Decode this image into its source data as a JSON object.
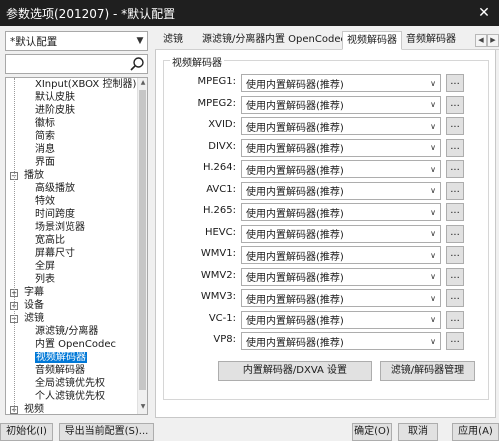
{
  "window": {
    "title": "参数选项(201207) - *默认配置",
    "close_label": "✕"
  },
  "profile_combo": {
    "value": "*默认配置"
  },
  "search": {
    "placeholder": ""
  },
  "tree": [
    {
      "label": "XInput(XBOX 控制器)",
      "level": 2
    },
    {
      "label": "默认皮肤",
      "level": 2
    },
    {
      "label": "进阶皮肤",
      "level": 2
    },
    {
      "label": "徽标",
      "level": 2
    },
    {
      "label": "简索",
      "level": 2
    },
    {
      "label": "消息",
      "level": 2
    },
    {
      "label": "界面",
      "level": 2
    },
    {
      "label": "播放",
      "level": 1,
      "expander": "−"
    },
    {
      "label": "高级播放",
      "level": 2
    },
    {
      "label": "特效",
      "level": 2
    },
    {
      "label": "时间跨度",
      "level": 2
    },
    {
      "label": "场景浏览器",
      "level": 2
    },
    {
      "label": "宽高比",
      "level": 2
    },
    {
      "label": "屏幕尺寸",
      "level": 2
    },
    {
      "label": "全屏",
      "level": 2
    },
    {
      "label": "列表",
      "level": 2
    },
    {
      "label": "字幕",
      "level": 1,
      "expander": "+"
    },
    {
      "label": "设备",
      "level": 1,
      "expander": "+"
    },
    {
      "label": "滤镜",
      "level": 1,
      "expander": "−"
    },
    {
      "label": "源滤镜/分离器",
      "level": 2
    },
    {
      "label": "内置 OpenCodec",
      "level": 2
    },
    {
      "label": "视频解码器",
      "level": 2,
      "selected": true
    },
    {
      "label": "音频解码器",
      "level": 2
    },
    {
      "label": "全局滤镜优先权",
      "level": 2
    },
    {
      "label": "个人滤镜优先权",
      "level": 2
    },
    {
      "label": "视频",
      "level": 1,
      "expander": "+"
    }
  ],
  "tabs": [
    {
      "label": "滤镜",
      "active": false
    },
    {
      "label": "源滤镜/分离器",
      "active": false
    },
    {
      "label": "内置 OpenCodec",
      "active": false
    },
    {
      "label": "视频解码器",
      "active": true
    },
    {
      "label": "音频解码器",
      "active": false
    }
  ],
  "tab_nav": {
    "prev": "◀",
    "next": "▶"
  },
  "group_title": "视频解码器",
  "decoders": [
    {
      "label": "MPEG1:",
      "value": "使用内置解码器(推荐)"
    },
    {
      "label": "MPEG2:",
      "value": "使用内置解码器(推荐)"
    },
    {
      "label": "XVID:",
      "value": "使用内置解码器(推荐)"
    },
    {
      "label": "DIVX:",
      "value": "使用内置解码器(推荐)"
    },
    {
      "label": "H.264:",
      "value": "使用内置解码器(推荐)"
    },
    {
      "label": "AVC1:",
      "value": "使用内置解码器(推荐)"
    },
    {
      "label": "H.265:",
      "value": "使用内置解码器(推荐)"
    },
    {
      "label": "HEVC:",
      "value": "使用内置解码器(推荐)"
    },
    {
      "label": "WMV1:",
      "value": "使用内置解码器(推荐)"
    },
    {
      "label": "WMV2:",
      "value": "使用内置解码器(推荐)"
    },
    {
      "label": "WMV3:",
      "value": "使用内置解码器(推荐)"
    },
    {
      "label": "VC-1:",
      "value": "使用内置解码器(推荐)"
    },
    {
      "label": "VP8:",
      "value": "使用内置解码器(推荐)"
    }
  ],
  "dots_label": "...",
  "panel_buttons": {
    "dxva": "内置解码器/DXVA 设置",
    "manage": "滤镜/解码器管理"
  },
  "bottom_buttons": {
    "init": "初始化(I)",
    "export": "导出当前配置(S)...",
    "ok": "确定(O)",
    "cancel": "取消",
    "apply": "应用(A)"
  },
  "colors": {
    "titlebar": "#1f1f1f",
    "selection": "#0078d7"
  }
}
